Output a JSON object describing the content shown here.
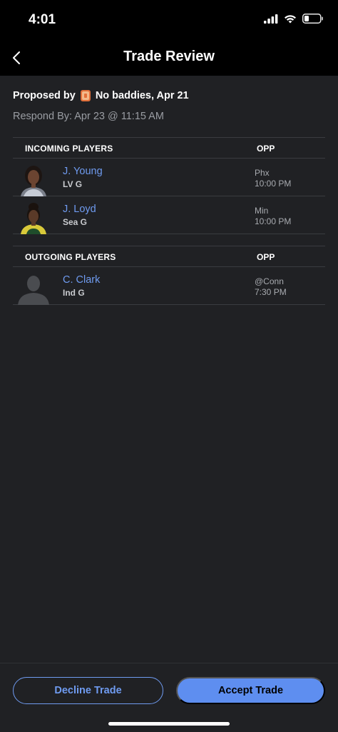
{
  "status_bar": {
    "time": "4:01"
  },
  "nav": {
    "title": "Trade Review"
  },
  "proposal": {
    "proposed_by_label": "Proposed by",
    "team_name": "No baddies, Apr 21",
    "respond_by": "Respond By: Apr 23 @ 11:15 AM"
  },
  "incoming": {
    "header": "INCOMING PLAYERS",
    "opp_header": "OPP",
    "players": [
      {
        "name": "J. Young",
        "team_pos": "LV G",
        "opp": "Phx",
        "time": "10:00 PM"
      },
      {
        "name": "J. Loyd",
        "team_pos": "Sea G",
        "opp": "Min",
        "time": "10:00 PM"
      }
    ]
  },
  "outgoing": {
    "header": "OUTGOING PLAYERS",
    "opp_header": "OPP",
    "players": [
      {
        "name": "C. Clark",
        "team_pos": "Ind G",
        "opp": "@Conn",
        "time": "7:30 PM"
      }
    ]
  },
  "footer": {
    "decline_label": "Decline Trade",
    "accept_label": "Accept Trade"
  },
  "colors": {
    "accent": "#6f9bf0",
    "accept_fill": "#5e8ef0",
    "background": "#202124"
  }
}
